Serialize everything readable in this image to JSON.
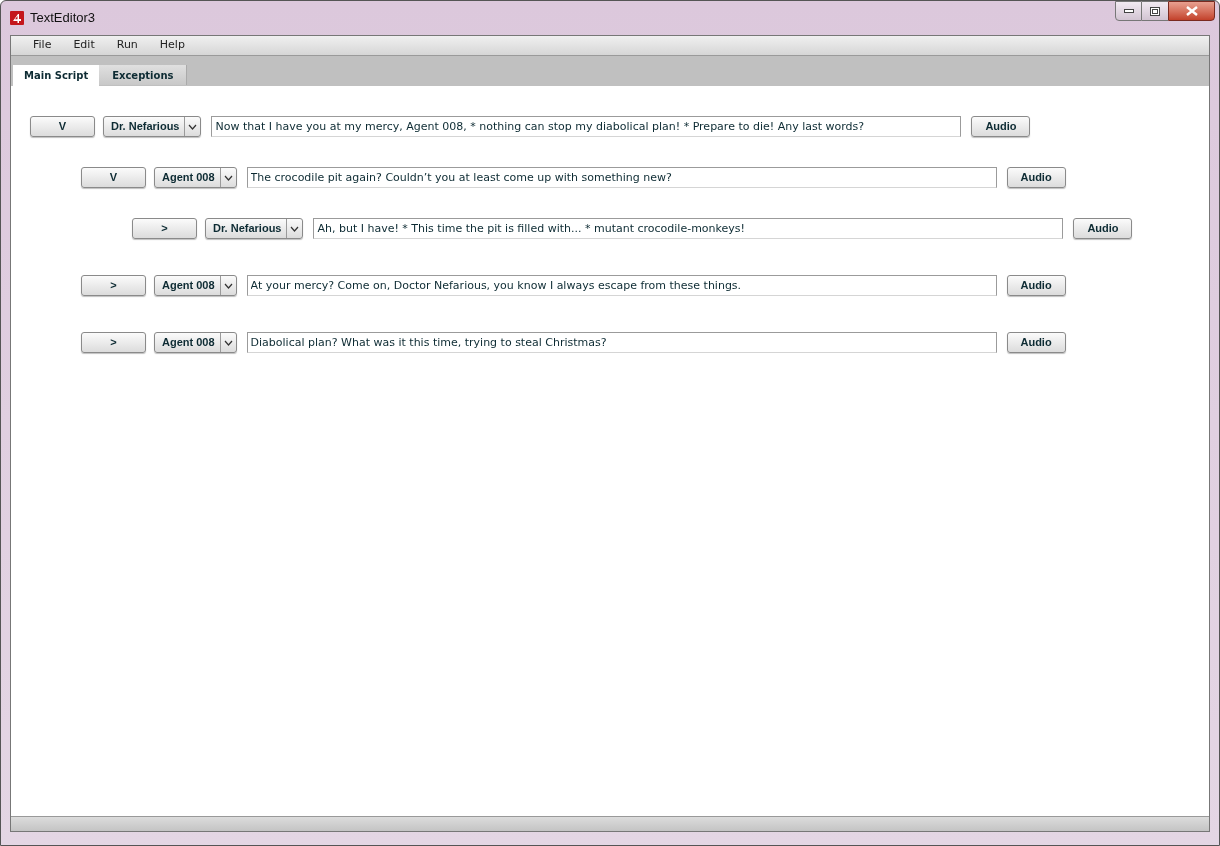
{
  "window": {
    "title": "TextEditor3"
  },
  "menu": [
    "File",
    "Edit",
    "Run",
    "Help"
  ],
  "tabs": [
    {
      "label": "Main Script",
      "selected": true
    },
    {
      "label": "Exceptions",
      "selected": false
    }
  ],
  "script_lines": [
    {
      "toggle": "V",
      "speaker": "Dr. Nefarious",
      "text": "Now that I have you at my mercy, Agent 008, * nothing can stop my diabolical plan! * Prepare to die! Any last words?",
      "audio": "Audio",
      "children": [
        {
          "toggle": "V",
          "speaker": "Agent 008",
          "text": "The crocodile pit again? Couldn’t you at least come up with something new?",
          "audio": "Audio",
          "children": [
            {
              "toggle": ">",
              "speaker": "Dr. Nefarious",
              "text": "Ah, but I have! * This time the pit is filled with... * mutant crocodile-monkeys!",
              "audio": "Audio"
            }
          ]
        },
        {
          "toggle": ">",
          "speaker": "Agent 008",
          "text": "At your mercy? Come on, Doctor Nefarious, you know I always escape from these things.",
          "audio": "Audio"
        },
        {
          "toggle": ">",
          "speaker": "Agent 008",
          "text": "Diabolical plan? What was it this time, trying to steal Christmas?",
          "audio": "Audio"
        }
      ]
    }
  ]
}
